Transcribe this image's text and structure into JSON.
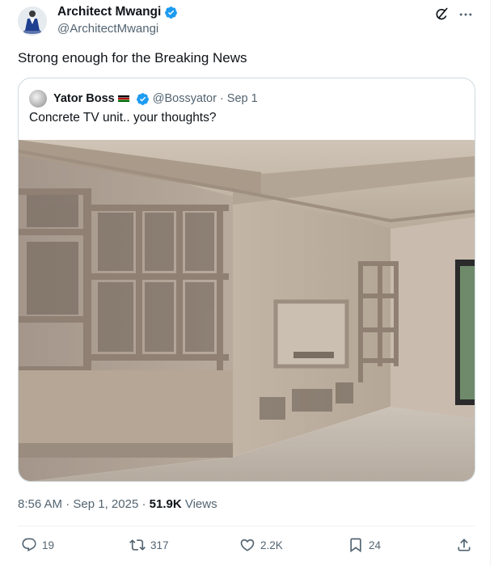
{
  "author": {
    "name": "Architect Mwangi",
    "handle": "@ArchitectMwangi",
    "verified": true
  },
  "tweet_text": "Strong enough for the Breaking News",
  "quote": {
    "name": "Yator Boss",
    "handle": "@Bossyator",
    "date_separator": "·",
    "date": "Sep 1",
    "text": "Concrete TV unit.. your thoughts?",
    "image_alt": "Unfinished concrete room with built-in shelving and a TV unit"
  },
  "meta": {
    "time": "8:56 AM",
    "date": "Sep 1, 2025",
    "views_count": "51.9K",
    "views_label": "Views"
  },
  "actions": {
    "replies": "19",
    "reposts": "317",
    "likes": "2.2K",
    "bookmarks": "24"
  },
  "colors": {
    "verified": "#1d9bf0",
    "secondary_text": "#536471",
    "border": "#cfd9de"
  },
  "icons": [
    "verified-badge-icon",
    "grok-icon",
    "more-icon",
    "reply-icon",
    "repost-icon",
    "like-icon",
    "bookmark-icon",
    "share-icon"
  ]
}
